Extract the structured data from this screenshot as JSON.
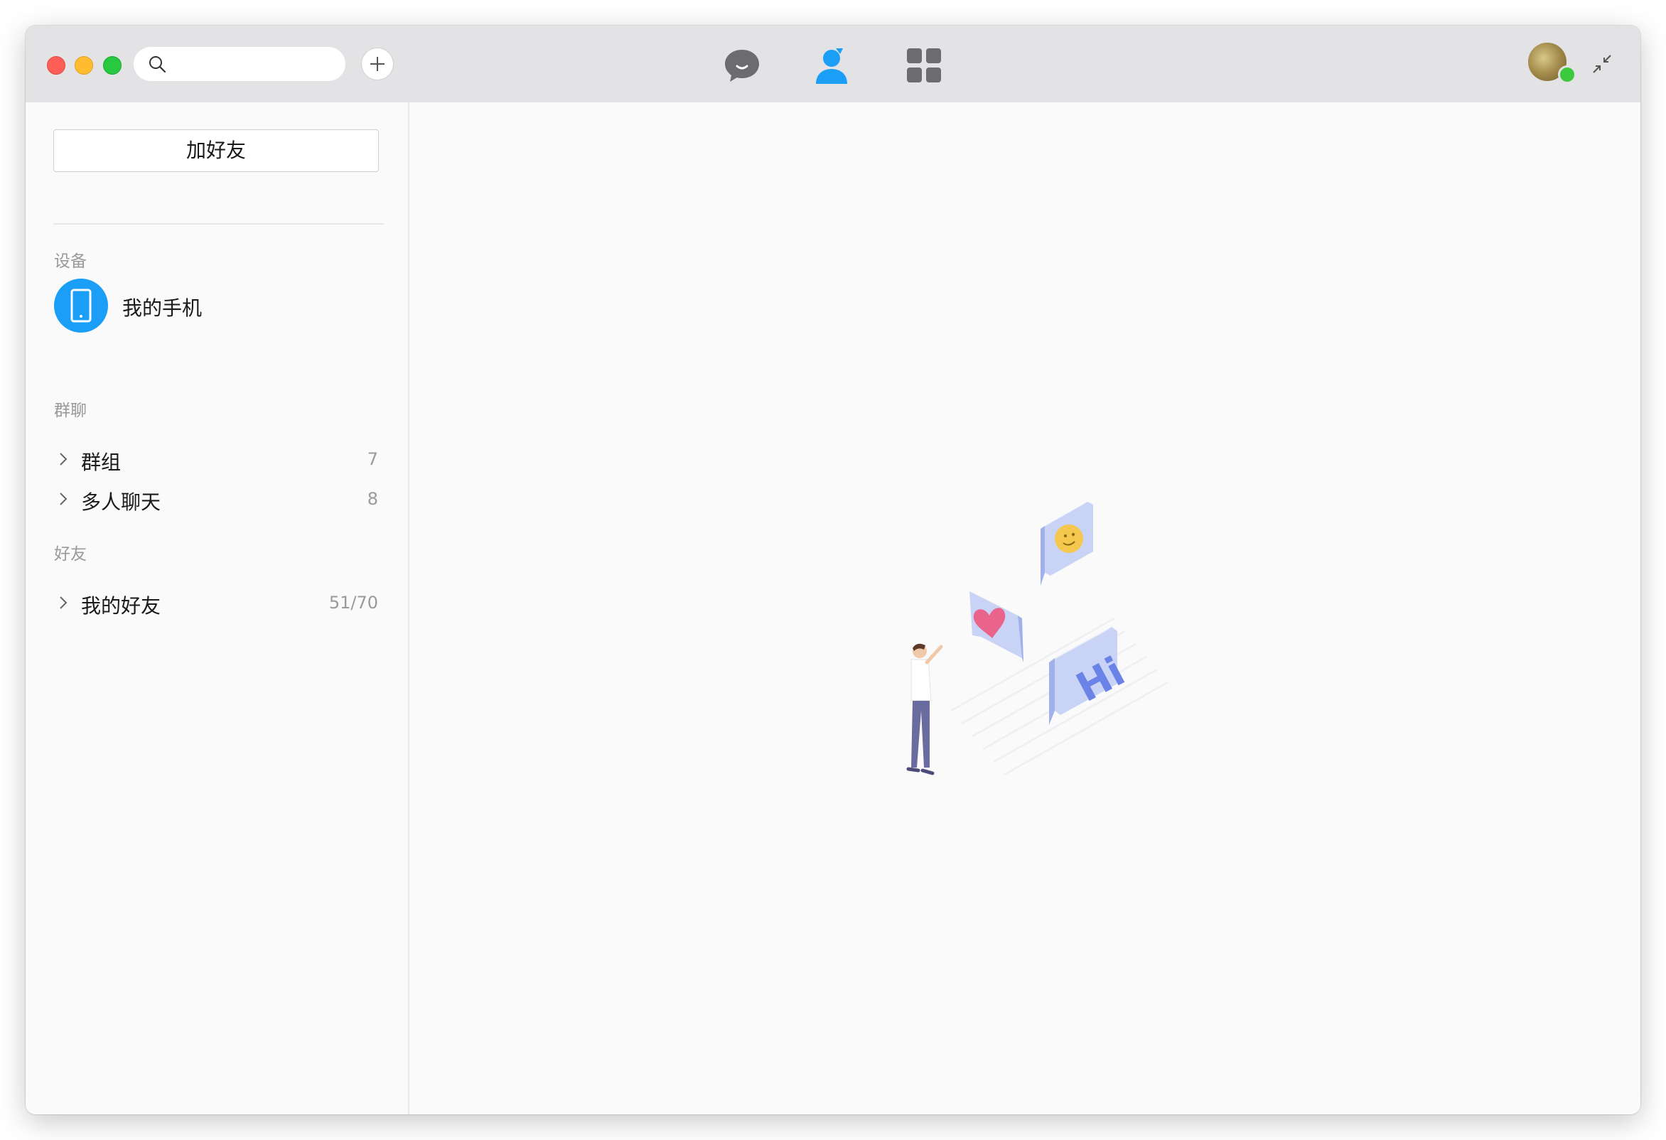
{
  "titlebar": {
    "search": {
      "placeholder": "",
      "value": ""
    },
    "nav": [
      {
        "name": "messages",
        "icon": "chat-bubble-icon",
        "active": false
      },
      {
        "name": "contacts",
        "icon": "person-icon",
        "active": true
      },
      {
        "name": "apps",
        "icon": "grid-icon",
        "active": false
      }
    ],
    "accent_color": "#1b9ef5",
    "status_color": "#3ac93f"
  },
  "sidebar": {
    "add_friend_label": "加好友",
    "devices": {
      "label": "设备",
      "items": [
        {
          "name": "我的手机",
          "icon": "tablet-icon"
        }
      ]
    },
    "groups": {
      "label": "群聊",
      "items": [
        {
          "name": "群组",
          "count": "7"
        },
        {
          "name": "多人聊天",
          "count": "8"
        }
      ]
    },
    "friends": {
      "label": "好友",
      "items": [
        {
          "name": "我的好友",
          "count": "51/70"
        }
      ]
    }
  },
  "main": {
    "illustration": {
      "bubble_text": "Hi",
      "icons": [
        "smiley-icon",
        "heart-icon"
      ]
    }
  }
}
